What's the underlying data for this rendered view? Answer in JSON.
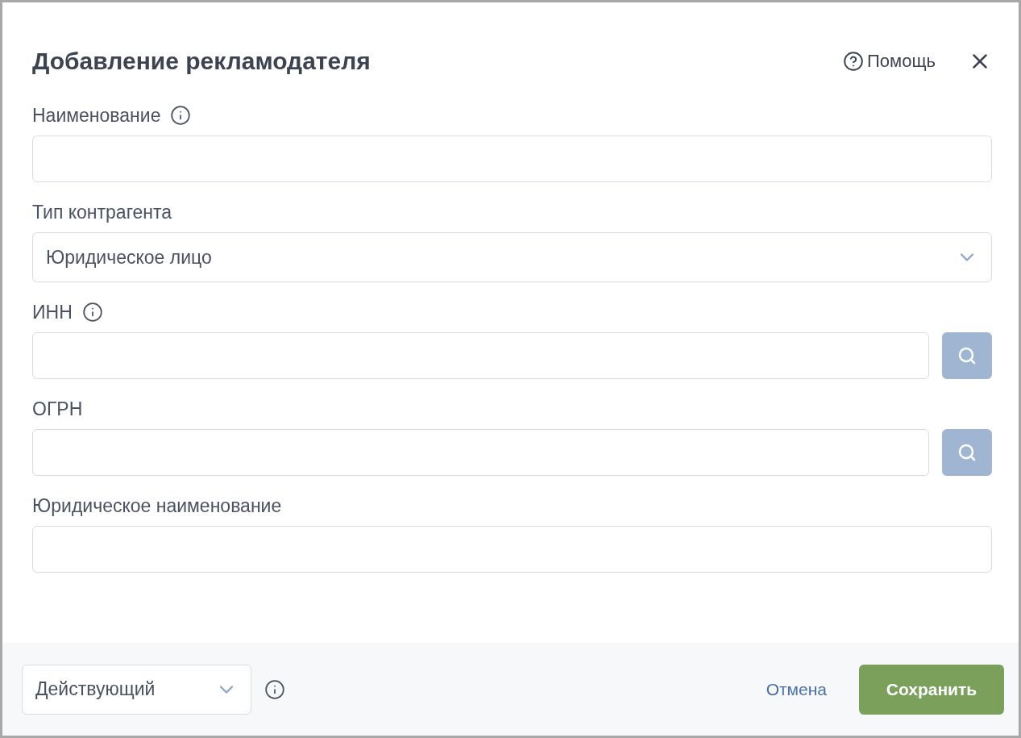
{
  "dialog": {
    "title": "Добавление рекламодателя",
    "help": "Помощь"
  },
  "fields": [
    {
      "kind": "text",
      "label": "Наименование",
      "info": true
    },
    {
      "kind": "select",
      "label": "Тип контрагента",
      "info": false,
      "value": "Юридическое лицо"
    },
    {
      "kind": "search",
      "label": "ИНН",
      "info": true
    },
    {
      "kind": "search",
      "label": "ОГРН",
      "info": false
    },
    {
      "kind": "text",
      "label": "Юридическое наименование",
      "info": false
    }
  ],
  "footer": {
    "status": "Действующий",
    "cancel": "Отмена",
    "save": "Сохранить"
  }
}
